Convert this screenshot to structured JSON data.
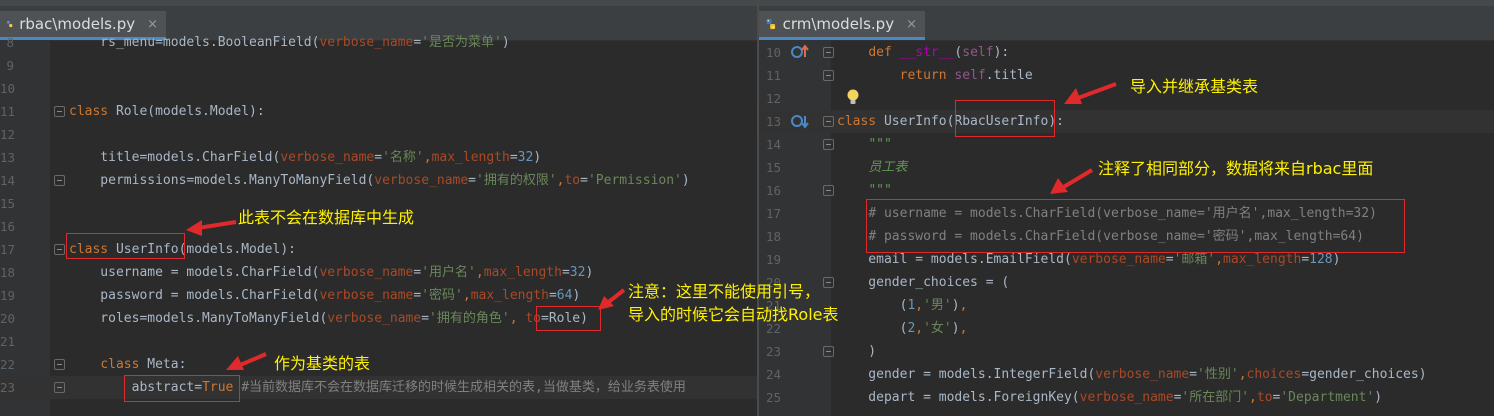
{
  "left_editor": {
    "tab_label": "rbac\\models.py",
    "close_glyph": "×",
    "lines": [
      {
        "num": "8",
        "html": "    rs_menu=models.BooleanField(<span class='param'>verbose_name</span>=<span class='str'>'是否为菜单'</span>)"
      },
      {
        "num": "9",
        "html": ""
      },
      {
        "num": "10",
        "html": ""
      },
      {
        "num": "11",
        "html": "<span class='kw'>class</span> Role(models.Model):"
      },
      {
        "num": "12",
        "html": ""
      },
      {
        "num": "13",
        "html": "    title=models.CharField(<span class='param'>verbose_name</span>=<span class='str'>'名称'</span><span class='kw'>,</span><span class='param'>max_length</span>=<span class='num'>32</span>)"
      },
      {
        "num": "14",
        "html": "    permissions=models.ManyToManyField(<span class='param'>verbose_name</span>=<span class='str'>'拥有的权限'</span><span class='kw'>,</span><span class='param'>to</span>=<span class='str'>'Permission'</span>)"
      },
      {
        "num": "15",
        "html": ""
      },
      {
        "num": "16",
        "html": ""
      },
      {
        "num": "17",
        "html": "<span class='kw'>class</span> UserInfo(models.Model):"
      },
      {
        "num": "18",
        "html": "    username = models.CharField(<span class='param'>verbose_name</span>=<span class='str'>'用户名'</span><span class='kw'>,</span><span class='param'>max_length</span>=<span class='num'>32</span>)"
      },
      {
        "num": "19",
        "html": "    password = models.CharField(<span class='param'>verbose_name</span>=<span class='str'>'密码'</span><span class='kw'>,</span><span class='param'>max_length</span>=<span class='num'>64</span>)"
      },
      {
        "num": "20",
        "html": "    roles=models.ManyToManyField(<span class='param'>verbose_name</span>=<span class='str'>'拥有的角色'</span><span class='kw'>,</span> <span class='param'>to</span>=Role)"
      },
      {
        "num": "21",
        "html": ""
      },
      {
        "num": "22",
        "html": "    <span class='kw'>class</span> Meta:"
      },
      {
        "num": "23",
        "html": "        abstract=<span class='kw'>True</span> <span class='com'>#当前数据库不会在数据库迁移的时候生成相关的表,当做基类，给业务表使用</span>"
      }
    ]
  },
  "right_editor": {
    "tab_label": "crm\\models.py",
    "close_glyph": "×",
    "lines": [
      {
        "num": "10",
        "html": "    <span class='kw'>def</span> <span style='color:#b200b2'>__str__</span>(<span class='self'>self</span>):"
      },
      {
        "num": "11",
        "html": "        <span class='kw'>return</span> <span class='self'>self</span>.title"
      },
      {
        "num": "12",
        "html": ""
      },
      {
        "num": "13",
        "html": "<span class='kw'>class</span> UserInfo(RbacUserInfo):"
      },
      {
        "num": "14",
        "html": "    <span class='doc'>\"\"\"</span>"
      },
      {
        "num": "15",
        "html": "    <span class='doc'>员工表</span>"
      },
      {
        "num": "16",
        "html": "    <span class='doc'>\"\"\"</span>"
      },
      {
        "num": "17",
        "html": "    <span class='com'># username = models.CharField(verbose_name='用户名',max_length=32)</span>"
      },
      {
        "num": "18",
        "html": "    <span class='com'># password = models.CharField(verbose_name='密码',max_length=64)</span>"
      },
      {
        "num": "19",
        "html": "    email = models.EmailField(<span class='param'>verbose_name</span>=<span class='str'>'邮箱'</span><span class='kw'>,</span><span class='param'>max_length</span>=<span class='num'>128</span>)"
      },
      {
        "num": "20",
        "html": "    gender_choices = ("
      },
      {
        "num": "21",
        "html": "        (<span class='num'>1</span><span class='kw'>,</span><span class='str'>'男'</span>)<span class='kw'>,</span>"
      },
      {
        "num": "22",
        "html": "        (<span class='num'>2</span><span class='kw'>,</span><span class='str'>'女'</span>)<span class='kw'>,</span>"
      },
      {
        "num": "23",
        "html": "    )"
      },
      {
        "num": "24",
        "html": "    gender = models.IntegerField(<span class='param'>verbose_name</span>=<span class='str'>'性别'</span><span class='kw'>,</span><span class='param'>choices</span>=gender_choices)"
      },
      {
        "num": "25",
        "html": "    depart = models.ForeignKey(<span class='param'>verbose_name</span>=<span class='str'>'所在部门'</span><span class='kw'>,</span><span class='param'>to</span>=<span class='str'>'Department'</span>)"
      }
    ]
  },
  "annotations": {
    "not_generated": "此表不会在数据库中生成",
    "note_line1": "注意：这里不能使用引号，",
    "note_line2": "导入的时候它会自动找Role表",
    "as_base": "作为基类的表",
    "import_inherit": "导入并继承基类表",
    "commented_same": "注释了相同部分，数据将来自rbac里面"
  },
  "colors": {
    "annotation_text": "#fff200",
    "annotation_box": "#e0292b",
    "editor_bg": "#2b2b2b"
  }
}
